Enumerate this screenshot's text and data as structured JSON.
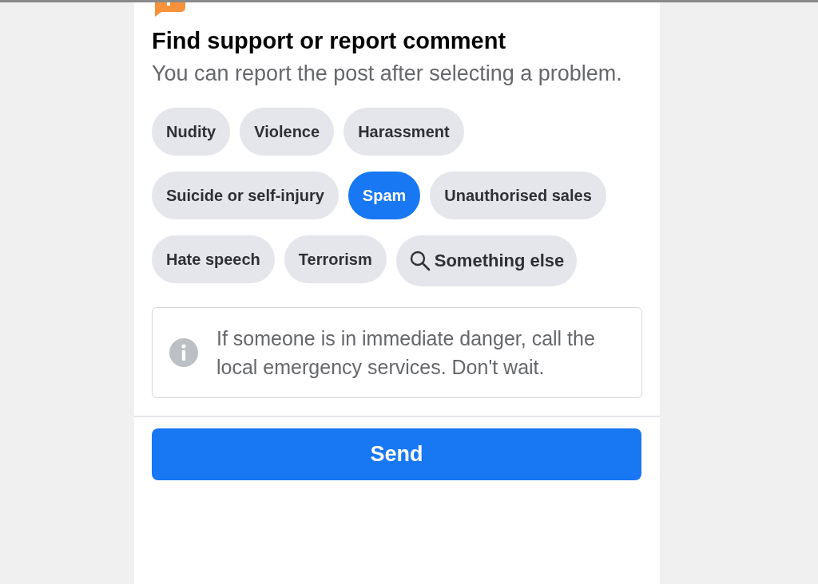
{
  "title": "Find support or report comment",
  "subtitle": "You can report the post after selecting a problem.",
  "topics": [
    {
      "label": "Nudity",
      "kind": "plain",
      "selected": false
    },
    {
      "label": "Violence",
      "kind": "plain",
      "selected": false
    },
    {
      "label": "Harassment",
      "kind": "plain",
      "selected": false
    },
    {
      "label": "Suicide or self-injury",
      "kind": "plain",
      "selected": false
    },
    {
      "label": "Spam",
      "kind": "plain",
      "selected": true
    },
    {
      "label": "Unauthorised sales",
      "kind": "plain",
      "selected": false
    },
    {
      "label": "Hate speech",
      "kind": "plain",
      "selected": false
    },
    {
      "label": "Terrorism",
      "kind": "plain",
      "selected": false
    },
    {
      "label": "Something else",
      "kind": "search",
      "selected": false
    }
  ],
  "notice": "If someone is in immediate danger, call the local emergency services. Don't wait.",
  "send_button": "Send"
}
